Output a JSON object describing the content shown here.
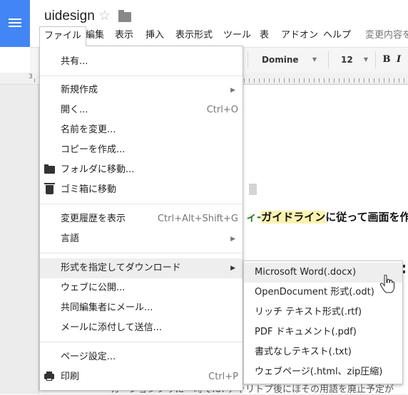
{
  "document": {
    "title": "uidesign",
    "body_line_1_prefix": "ィ-",
    "body_line_1_highlight": "ガイドライン",
    "body_line_1_rest": "に従って画面を作成",
    "body_line_2": "カーションフリに一時でIUFチャリトプ後にほその用語を廃止予定が"
  },
  "menubar": {
    "items": [
      "ファイル",
      "編集",
      "表示",
      "挿入",
      "表示形式",
      "ツール",
      "表",
      "アドオン",
      "ヘルプ"
    ],
    "save_status": "変更内容を"
  },
  "toolbar": {
    "font": "Domine",
    "size": "12",
    "bold": "B",
    "italic": "I"
  },
  "ruler": {
    "label": "3"
  },
  "file_menu": {
    "share": "共有...",
    "new": "新規作成",
    "open": "開く...",
    "open_shortcut": "Ctrl+O",
    "rename": "名前を変更...",
    "copy": "コピーを作成...",
    "move_to_folder": "フォルダに移動...",
    "move_to_trash": "ゴミ箱に移動",
    "revision_history": "変更履歴を表示",
    "revision_history_shortcut": "Ctrl+Alt+Shift+G",
    "language": "言語",
    "download_as": "形式を指定してダウンロード",
    "publish": "ウェブに公開...",
    "email_collaborators": "共同編集者にメール...",
    "email_attachment": "メールに添付して送信...",
    "page_setup": "ページ設定...",
    "print": "印刷",
    "print_shortcut": "Ctrl+P"
  },
  "download_submenu": {
    "items": [
      "Microsoft Word(.docx)",
      "OpenDocument 形式(.odt)",
      "リッチ テキスト形式(.rtf)",
      "PDF ドキュメント(.pdf)",
      "書式なしテキスト(.txt)",
      "ウェブページ(.html、zip圧縮)"
    ],
    "hover_index": 0
  },
  "colors": {
    "accent": "#4285f4",
    "highlight": "#fdf2b0",
    "menu_hover": "#eeeeee"
  }
}
